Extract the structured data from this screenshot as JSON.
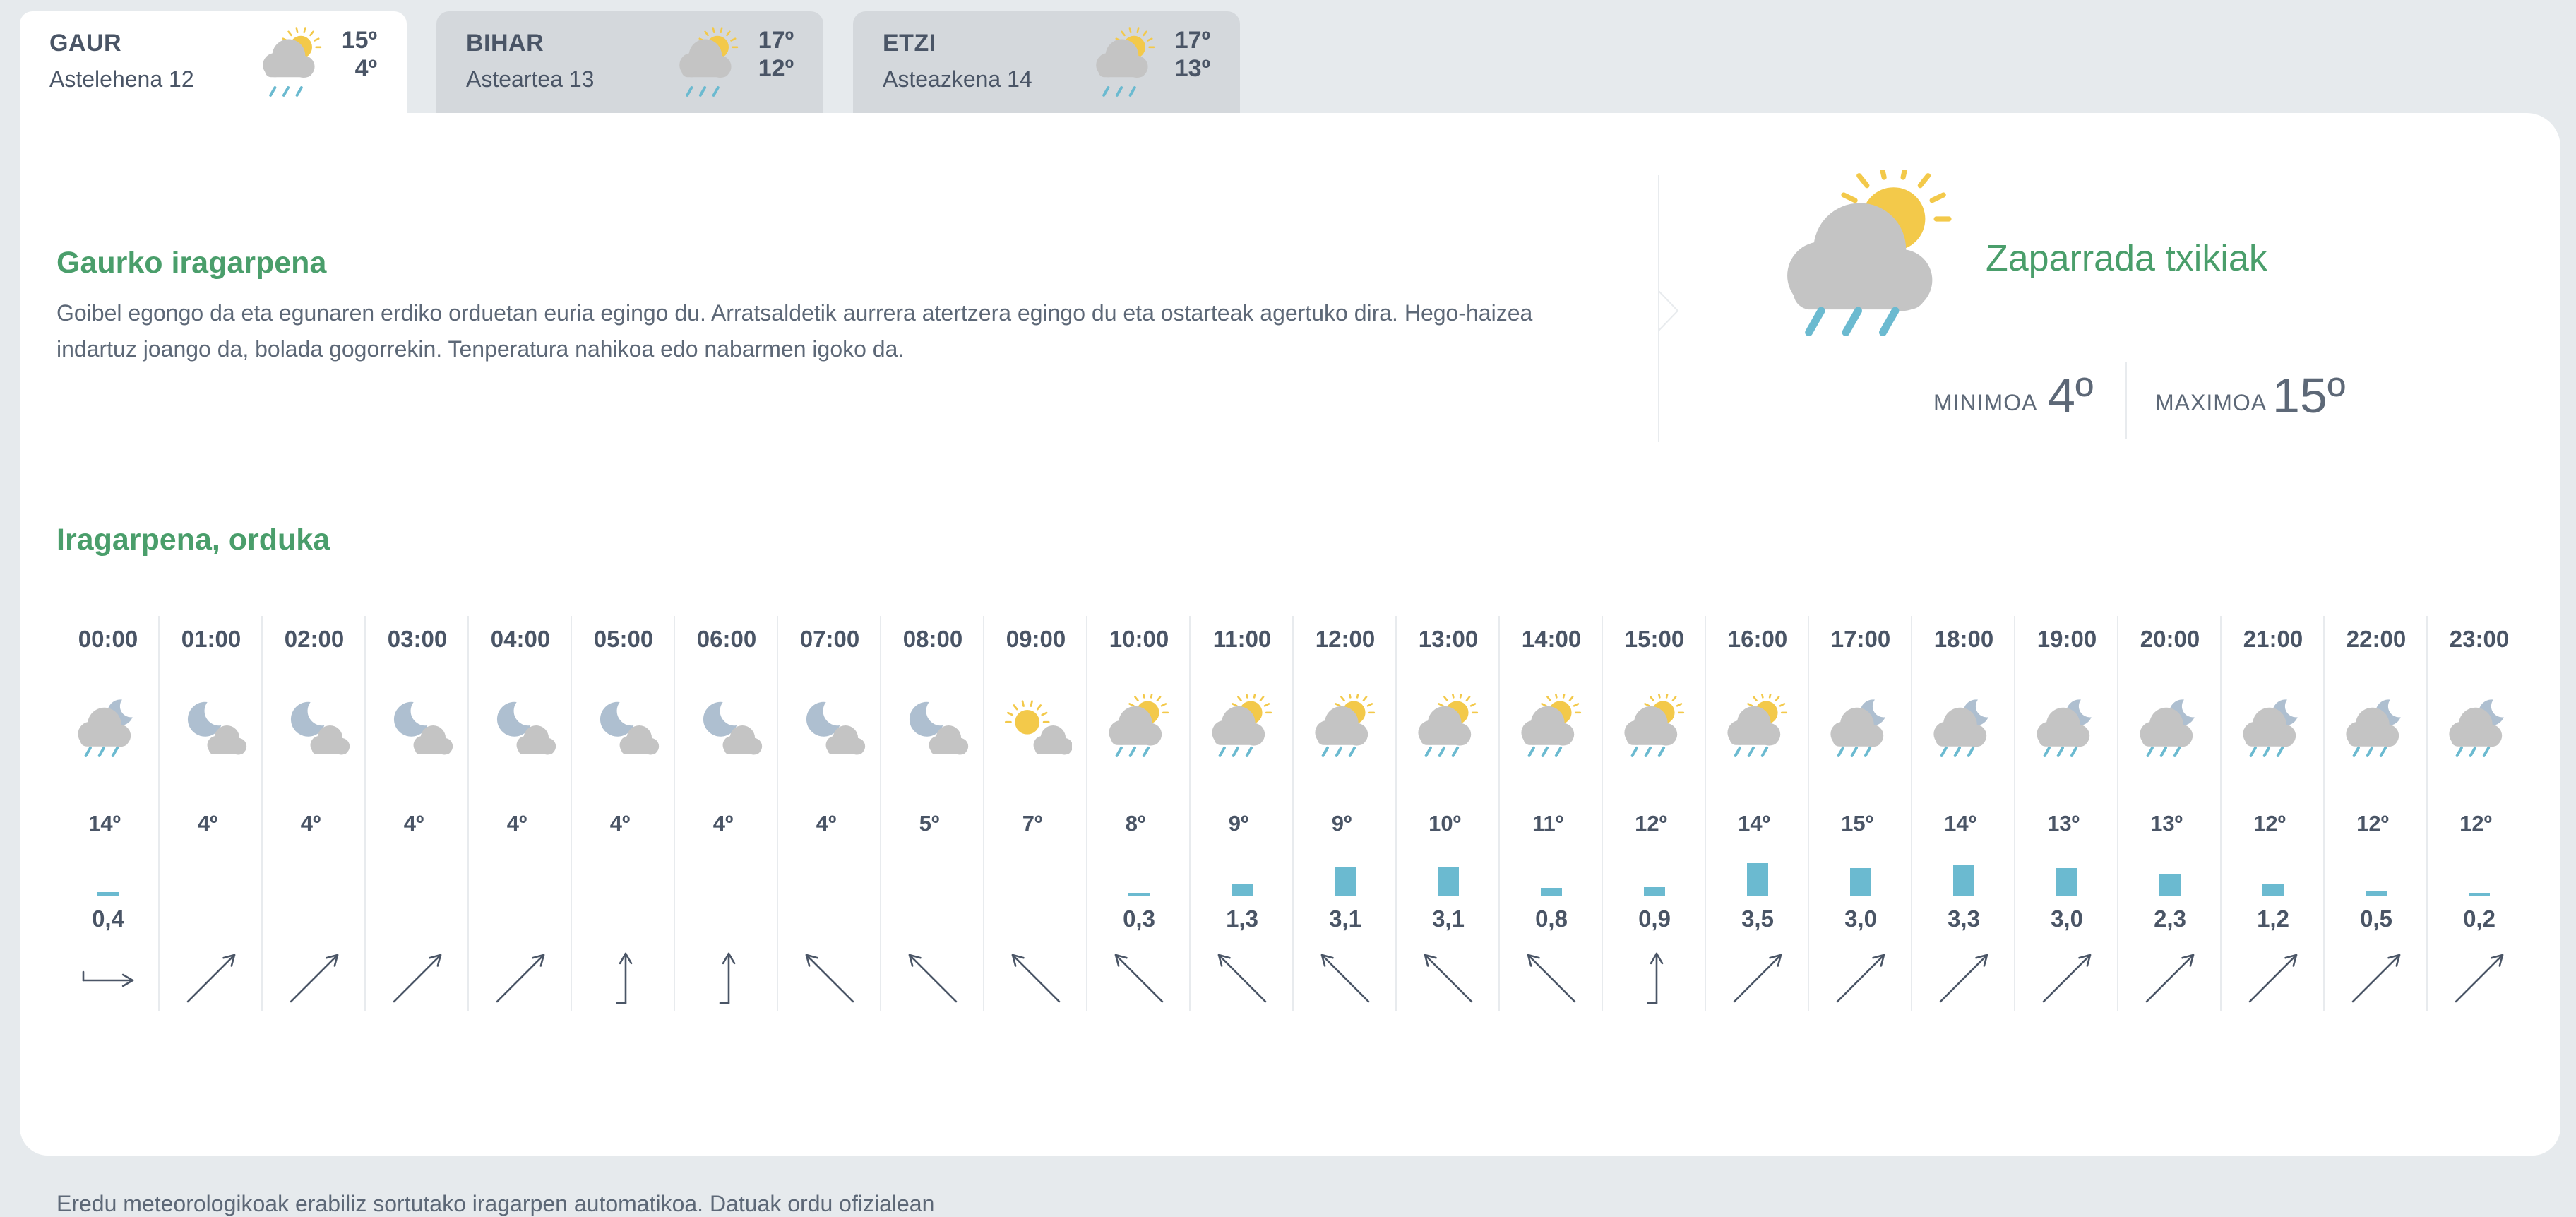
{
  "tabs": [
    {
      "day": "GAUR",
      "date": "Astelehena 12",
      "max": "15º",
      "min": "4º",
      "icon": "sun-cloud-rain-icon",
      "active": true
    },
    {
      "day": "BIHAR",
      "date": "Asteartea 13",
      "max": "17º",
      "min": "12º",
      "icon": "sun-cloud-rain-icon",
      "active": false
    },
    {
      "day": "ETZI",
      "date": "Asteazkena 14",
      "max": "17º",
      "min": "13º",
      "icon": "sun-cloud-rain-icon",
      "active": false
    }
  ],
  "today": {
    "title": "Gaurko iragarpena",
    "text": "Goibel egongo da eta egunaren erdiko orduetan euria egingo du. Arratsaldetik aurrera atertzera egingo du eta ostarteak agertuko dira. Hego-haizea indartuz joango da, bolada gogorrekin. Tenperatura nahikoa edo nabarmen igoko da.",
    "summary": "Zaparrada txikiak",
    "min_label": "MINIMOA",
    "min_value": "4º",
    "max_label": "MAXIMOA",
    "max_value": "15º"
  },
  "hourly_title": "Iragarpena, orduka",
  "hours": [
    {
      "time": "00:00",
      "icon": "moon-cloud-rain-icon",
      "temp": "14º",
      "prec": "0,4",
      "prec_value": 0.4,
      "wind": "wind-east-icon"
    },
    {
      "time": "01:00",
      "icon": "moon-cloud-icon",
      "temp": "4º",
      "prec": "",
      "prec_value": 0,
      "wind": "wind-northeast-icon"
    },
    {
      "time": "02:00",
      "icon": "moon-cloud-icon",
      "temp": "4º",
      "prec": "",
      "prec_value": 0,
      "wind": "wind-northeast-icon"
    },
    {
      "time": "03:00",
      "icon": "moon-cloud-icon",
      "temp": "4º",
      "prec": "",
      "prec_value": 0,
      "wind": "wind-northeast-icon"
    },
    {
      "time": "04:00",
      "icon": "moon-cloud-icon",
      "temp": "4º",
      "prec": "",
      "prec_value": 0,
      "wind": "wind-northeast-icon"
    },
    {
      "time": "05:00",
      "icon": "moon-cloud-icon",
      "temp": "4º",
      "prec": "",
      "prec_value": 0,
      "wind": "wind-north-icon"
    },
    {
      "time": "06:00",
      "icon": "moon-cloud-icon",
      "temp": "4º",
      "prec": "",
      "prec_value": 0,
      "wind": "wind-north-icon"
    },
    {
      "time": "07:00",
      "icon": "moon-cloud-icon",
      "temp": "4º",
      "prec": "",
      "prec_value": 0,
      "wind": "wind-northwest-icon"
    },
    {
      "time": "08:00",
      "icon": "moon-cloud-icon",
      "temp": "5º",
      "prec": "",
      "prec_value": 0,
      "wind": "wind-northwest-icon"
    },
    {
      "time": "09:00",
      "icon": "sun-cloud-icon",
      "temp": "7º",
      "prec": "",
      "prec_value": 0,
      "wind": "wind-northwest-icon"
    },
    {
      "time": "10:00",
      "icon": "sun-cloud-rain-icon",
      "temp": "8º",
      "prec": "0,3",
      "prec_value": 0.3,
      "wind": "wind-northwest-icon"
    },
    {
      "time": "11:00",
      "icon": "sun-cloud-rain-icon",
      "temp": "9º",
      "prec": "1,3",
      "prec_value": 1.3,
      "wind": "wind-northwest-icon"
    },
    {
      "time": "12:00",
      "icon": "sun-cloud-rain-icon",
      "temp": "9º",
      "prec": "3,1",
      "prec_value": 3.1,
      "wind": "wind-northwest-icon"
    },
    {
      "time": "13:00",
      "icon": "sun-cloud-rain-icon",
      "temp": "10º",
      "prec": "3,1",
      "prec_value": 3.1,
      "wind": "wind-northwest-icon"
    },
    {
      "time": "14:00",
      "icon": "sun-cloud-rain-icon",
      "temp": "11º",
      "prec": "0,8",
      "prec_value": 0.8,
      "wind": "wind-northwest-icon"
    },
    {
      "time": "15:00",
      "icon": "sun-cloud-rain-icon",
      "temp": "12º",
      "prec": "0,9",
      "prec_value": 0.9,
      "wind": "wind-north-icon"
    },
    {
      "time": "16:00",
      "icon": "sun-cloud-rain-icon",
      "temp": "14º",
      "prec": "3,5",
      "prec_value": 3.5,
      "wind": "wind-northeast-icon"
    },
    {
      "time": "17:00",
      "icon": "moon-cloud-rain-icon",
      "temp": "15º",
      "prec": "3,0",
      "prec_value": 3.0,
      "wind": "wind-northeast-icon"
    },
    {
      "time": "18:00",
      "icon": "moon-cloud-rain-icon",
      "temp": "14º",
      "prec": "3,3",
      "prec_value": 3.3,
      "wind": "wind-northeast-icon"
    },
    {
      "time": "19:00",
      "icon": "moon-cloud-rain-icon",
      "temp": "13º",
      "prec": "3,0",
      "prec_value": 3.0,
      "wind": "wind-northeast-icon"
    },
    {
      "time": "20:00",
      "icon": "moon-cloud-rain-icon",
      "temp": "13º",
      "prec": "2,3",
      "prec_value": 2.3,
      "wind": "wind-northeast-icon"
    },
    {
      "time": "21:00",
      "icon": "moon-cloud-rain-icon",
      "temp": "12º",
      "prec": "1,2",
      "prec_value": 1.2,
      "wind": "wind-northeast-icon"
    },
    {
      "time": "22:00",
      "icon": "moon-cloud-rain-icon",
      "temp": "12º",
      "prec": "0,5",
      "prec_value": 0.5,
      "wind": "wind-northeast-icon"
    },
    {
      "time": "23:00",
      "icon": "moon-cloud-rain-icon",
      "temp": "12º",
      "prec": "0,2",
      "prec_value": 0.2,
      "wind": "wind-northeast-icon"
    }
  ],
  "footnote": "Eredu meteorologikoak erabiliz sortutako iragarpen automatikoa. Datuak ordu ofizialean",
  "colors": {
    "accent_green": "#4a9e6b",
    "rain_bar": "#6bbad0",
    "sun": "#f3c94a",
    "cloud": "#c4c4c4",
    "moon": "#aebfd0",
    "rain_drop": "#6bbad0"
  }
}
